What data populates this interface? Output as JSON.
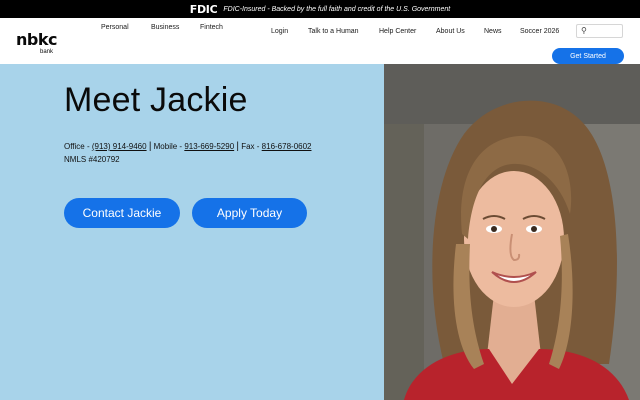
{
  "fdic": {
    "logo": "FDIC",
    "text": "FDIC-Insured - Backed by the full faith and credit of the U.S. Government"
  },
  "brand": {
    "name": "nbkc",
    "sub": "bank"
  },
  "segments": [
    "Personal",
    "Business",
    "Fintech"
  ],
  "nav": {
    "login": "Login",
    "talk": "Talk to a Human",
    "help": "Help Center",
    "about": "About Us",
    "news": "News",
    "soccer": "Soccer 2026"
  },
  "search": {
    "placeholder": "",
    "icon": "search-icon"
  },
  "cta": {
    "get_started": "Get Started"
  },
  "hero": {
    "title": "Meet Jackie",
    "office_label": "Office - ",
    "office_phone": "(913) 914-9460",
    "mobile_label": " Mobile - ",
    "mobile_phone": "913-669-5290",
    "fax_label": " Fax - ",
    "fax_phone": "816-678-0602",
    "separator": "|",
    "nmls": "NMLS #420792",
    "contact_button": "Contact Jackie",
    "apply_button": "Apply Today"
  },
  "colors": {
    "accent": "#1572e8",
    "hero_bg": "#a8d3ea",
    "fdic_bar": "#000000"
  }
}
